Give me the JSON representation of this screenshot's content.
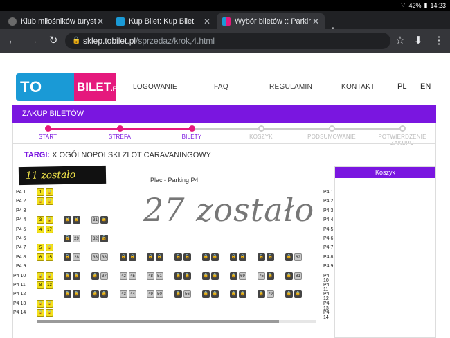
{
  "status": {
    "battery": "42%",
    "time": "14:23"
  },
  "tabs": [
    {
      "title": "Klub miłośników turysty",
      "active": false,
      "fav_color": "#6b6b6b"
    },
    {
      "title": "Kup Bilet: Kup Bilet",
      "active": false,
      "fav_color": "#1a9ad6"
    },
    {
      "title": "Wybór biletów :: Parking",
      "active": true,
      "fav_color": "#e5197d"
    }
  ],
  "toolbar": {
    "back_icon": "←",
    "forward_icon": "→",
    "reload_icon": "↻",
    "url_host": "sklep.tobilet.pl",
    "url_path": "/sprzedaz/krok,4.html",
    "star_icon": "☆",
    "download_icon": "⬇",
    "menu_icon": "⋮",
    "lock_icon": "🔒"
  },
  "site": {
    "logo_left": "TO",
    "logo_right": "BILET",
    "logo_suffix": ".PL",
    "nav": [
      "LOGOWANIE",
      "FAQ",
      "REGULAMIN",
      "KONTAKT"
    ],
    "langs": [
      "PL",
      "EN"
    ]
  },
  "purchase_title": "ZAKUP BILETÓW",
  "steps": [
    {
      "label": "START",
      "done": true
    },
    {
      "label": "STREFA",
      "done": true
    },
    {
      "label": "BILETY",
      "done": true
    },
    {
      "label": "KOSZYK",
      "done": false
    },
    {
      "label": "PODSUMOWANIE",
      "done": false
    },
    {
      "label": "POTWIERDZENIE ZAKUPU",
      "done": false
    }
  ],
  "colors": {
    "accent": "#7a16e0",
    "pink": "#e5197d",
    "step_inactive": "#cccccc",
    "free_seat": "#f3e21c"
  },
  "event": {
    "key": "TARGI:",
    "name": "X OGÓLNOPOLSKI ZLOT CARAVANINGOWY"
  },
  "map": {
    "title": "Plac - Parking P4",
    "note_topleft": "11 zostało",
    "note_handwritten": "27 zostało",
    "rows": [
      "P4 1",
      "P4 2",
      "P4 3",
      "P4 4",
      "P4 5",
      "P4 6",
      "P4 7",
      "P4 8",
      "P4 9",
      "P4 10",
      "P4 11",
      "P4 12",
      "P4 13",
      "P4 14"
    ],
    "free_seats": [
      "1",
      "3",
      "4",
      "17",
      "5",
      "6",
      "15",
      "7",
      "9",
      "8",
      "13",
      "10",
      "11"
    ],
    "numbered_seats": [
      "31",
      "29",
      "32",
      "28",
      "33",
      "38",
      "37",
      "42",
      "45",
      "48",
      "51",
      "56",
      "69",
      "75",
      "81",
      "82",
      "43",
      "44",
      "49",
      "50",
      "56",
      "79"
    ]
  },
  "cart": {
    "title": "Koszyk"
  }
}
